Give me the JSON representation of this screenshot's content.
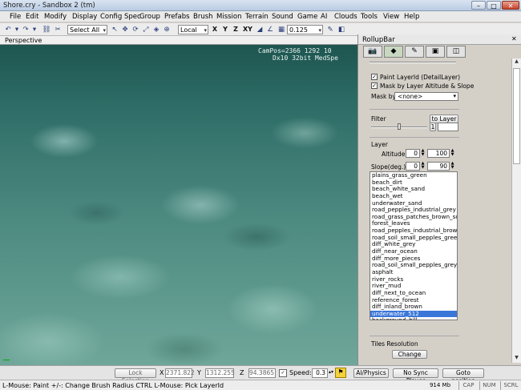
{
  "window": {
    "title": "Shore.cry - Sandbox 2 (tm)",
    "minimize": "–",
    "maximize": "□",
    "close": "✕"
  },
  "menu": [
    "File",
    "Edit",
    "Modify",
    "Display",
    "Config Spec",
    "Group",
    "Prefabs",
    "Brush",
    "Mission",
    "Terrain",
    "Sound",
    "Game",
    "AI",
    "Clouds",
    "Tools",
    "View",
    "Help"
  ],
  "toolbar": {
    "selection_filter": "Select All",
    "coord_system": "Local",
    "axes": [
      "X",
      "Y",
      "Z",
      "XY"
    ],
    "grid_size": "0.125"
  },
  "viewport": {
    "label": "Perspective",
    "cam_pos": "CamPos=2366 1292 10",
    "renderer": "Dx10 32bit MedSpe"
  },
  "rollup": {
    "title": "RollupBar",
    "paint_layer_label": "Paint LayerId (DetailLayer)",
    "paint_layer_checked": true,
    "mask_label": "Mask by Layer Altitude & Slope",
    "mask_checked": true,
    "mask_by_label": "Mask by",
    "mask_by_value": "<none>",
    "filter_label": "Filter",
    "to_layer_button": "to Layer",
    "filter_value": "1",
    "layer_section": "Layer",
    "altitude_label": "Altitude",
    "altitude_min": "0",
    "altitude_max": "100",
    "slope_label": "Slope(deg.)",
    "slope_min": "0",
    "slope_max": "90",
    "layers": [
      "plains_grass_green",
      "beach_dirt",
      "beach_white_sand",
      "beach_wet",
      "underwater_sand",
      "road_pepples_industrial_grey",
      "road_grass_patches_brown_soil",
      "forest_leaves",
      "road_pepples_industrial_brown",
      "road_soil_small_pepples_green",
      "diff_white_grey",
      "diff_near_ocean",
      "diff_more_pieces",
      "road_soil_small_pepples_grey",
      "asphalt",
      "river_rocks",
      "river_mud",
      "diff_next_to_ocean",
      "reference_forest",
      "diff_inland_brown",
      "underwater_512",
      "background_hill"
    ],
    "selected_layer": "underwater_512",
    "tiles_resolution_label": "Tiles Resolution",
    "change_button": "Change"
  },
  "controls": {
    "lock_selection": "Lock Selection",
    "x_label": "X",
    "x_value": "2371.822",
    "y_label": "Y",
    "y_value": "1312.255",
    "z_label": "Z",
    "z_value": "94.3865",
    "speed_label": "Speed:",
    "speed_value": "0.3",
    "ai_physics": "AI/Physics",
    "no_sync_player": "No Sync Player",
    "goto_position": "Goto position"
  },
  "status": {
    "hint": "L-Mouse: Paint   +/-: Change Brush Radius   CTRL L-Mouse: Pick LayerId",
    "memory": "914 Mb",
    "cap": "CAP",
    "num": "NUM",
    "scrl": "SCRL"
  }
}
